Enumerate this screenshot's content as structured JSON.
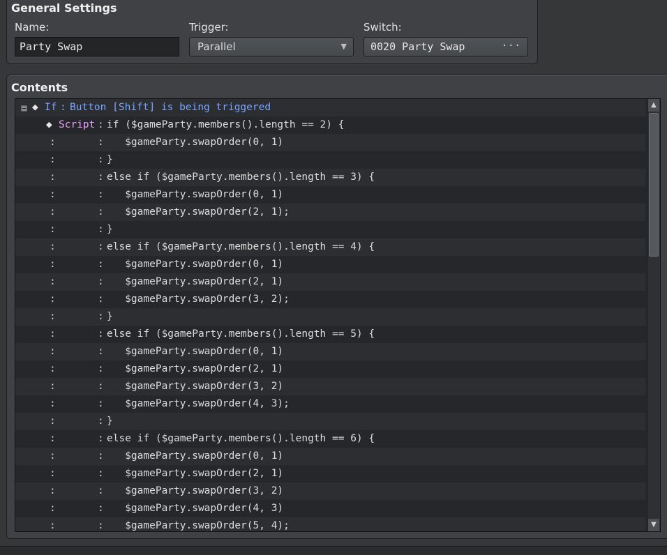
{
  "general": {
    "title": "General Settings",
    "name_label": "Name:",
    "name_value": "Party Swap",
    "trigger_label": "Trigger:",
    "trigger_value": "Parallel",
    "switch_label": "Switch:",
    "switch_value": "0020 Party Swap",
    "switch_button": "···"
  },
  "contents": {
    "title": "Contents",
    "colon": ":",
    "diamond": "◆",
    "if_keyword": "If",
    "if_text": "Button [Shift] is being triggered",
    "script_keyword": "Script",
    "script_lines": [
      "if ($gameParty.members().length == 2) {",
      "   $gameParty.swapOrder(0, 1)",
      "}",
      "else if ($gameParty.members().length == 3) {",
      "   $gameParty.swapOrder(0, 1)",
      "   $gameParty.swapOrder(2, 1);",
      "}",
      "else if ($gameParty.members().length == 4) {",
      "   $gameParty.swapOrder(0, 1)",
      "   $gameParty.swapOrder(2, 1)",
      "   $gameParty.swapOrder(3, 2);",
      "}",
      "else if ($gameParty.members().length == 5) {",
      "   $gameParty.swapOrder(0, 1)",
      "   $gameParty.swapOrder(2, 1)",
      "   $gameParty.swapOrder(3, 2)",
      "   $gameParty.swapOrder(4, 3);",
      "}",
      "else if ($gameParty.members().length == 6) {",
      "   $gameParty.swapOrder(0, 1)",
      "   $gameParty.swapOrder(2, 1)",
      "   $gameParty.swapOrder(3, 2)",
      "   $gameParty.swapOrder(4, 3)",
      "   $gameParty.swapOrder(5, 4);"
    ]
  },
  "colors": {
    "if_keyword": "#7aa6ff",
    "script_keyword": "#eaa0ff",
    "background": "#353739",
    "list_background": "#242628"
  },
  "icons": {
    "collapse": "collapse-toggle-icon",
    "dropdown": "chevron-down-icon",
    "scroll_up": "arrow-up-icon",
    "scroll_down": "arrow-down-icon"
  }
}
